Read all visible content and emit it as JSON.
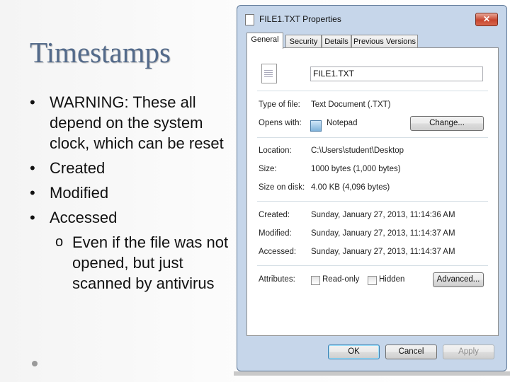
{
  "slide": {
    "title": "Timestamps",
    "bullets": [
      "WARNING: These all depend on the system clock, which can be reset",
      "Created",
      "Modified",
      "Accessed"
    ],
    "sub_bullet": "Even if the file was not opened, but just scanned by antivirus",
    "bullet_marker": "•",
    "sub_marker": "o"
  },
  "dialog": {
    "title": "FILE1.TXT Properties",
    "close_label": "✕",
    "tabs": [
      "General",
      "Security",
      "Details",
      "Previous Versions"
    ],
    "active_tab": "General",
    "file_name": "FILE1.TXT",
    "fields": {
      "type_label": "Type of file:",
      "type_value": "Text Document (.TXT)",
      "opens_label": "Opens with:",
      "opens_value": "Notepad",
      "change_button": "Change...",
      "location_label": "Location:",
      "location_value": "C:\\Users\\student\\Desktop",
      "size_label": "Size:",
      "size_value": "1000 bytes (1,000 bytes)",
      "size_disk_label": "Size on disk:",
      "size_disk_value": "4.00 KB (4,096 bytes)",
      "created_label": "Created:",
      "created_value": "Sunday, January 27, 2013, 11:14:36 AM",
      "modified_label": "Modified:",
      "modified_value": "Sunday, January 27, 2013, 11:14:37 AM",
      "accessed_label": "Accessed:",
      "accessed_value": "Sunday, January 27, 2013, 11:14:37 AM",
      "attributes_label": "Attributes:",
      "readonly_label": "Read-only",
      "readonly_checked": false,
      "hidden_label": "Hidden",
      "hidden_checked": false,
      "advanced_button": "Advanced..."
    },
    "buttons": {
      "ok": "OK",
      "cancel": "Cancel",
      "apply": "Apply"
    }
  }
}
